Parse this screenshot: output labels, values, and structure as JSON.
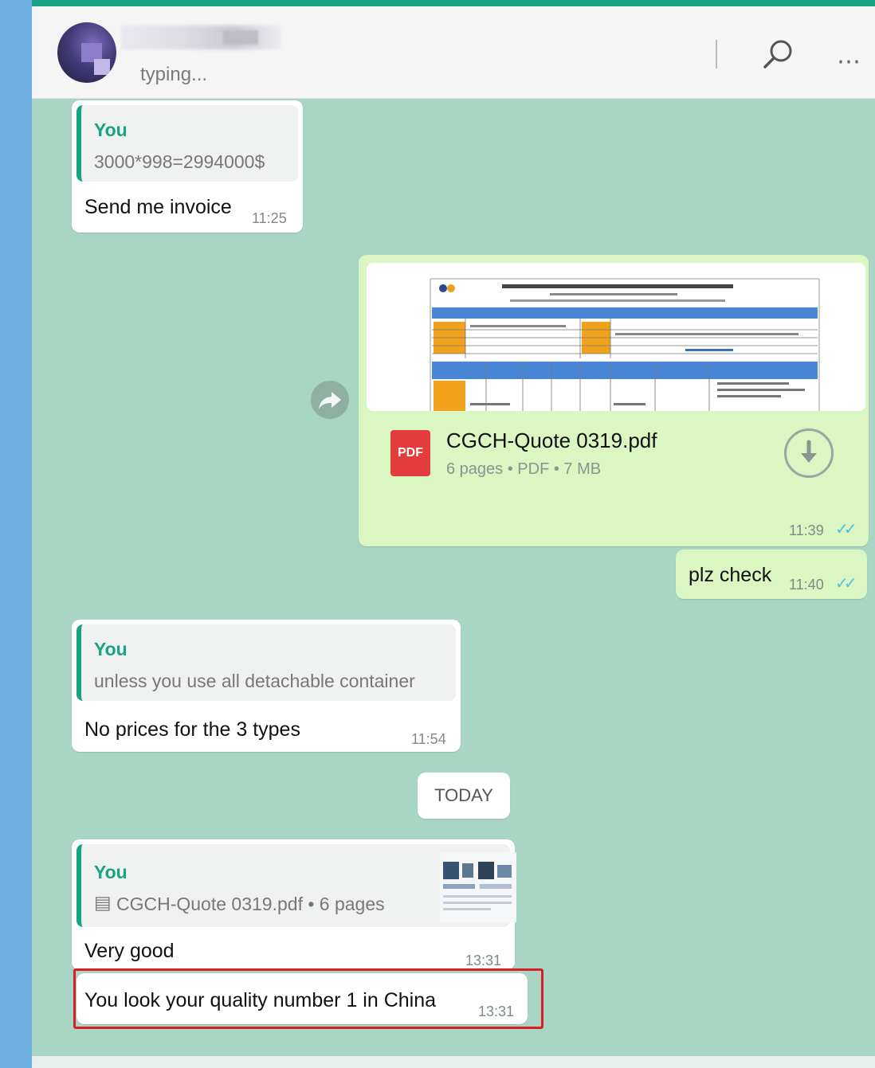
{
  "header": {
    "status": "typing..."
  },
  "icons": {
    "search": "search-icon",
    "more": "more-icon",
    "forward": "forward-icon",
    "download": "download-icon",
    "pdf": "pdf-icon",
    "ticks": "double-check-icon",
    "doc": "document-icon"
  },
  "colors": {
    "accent": "#1aa383",
    "chat_bg": "#a9d5c5",
    "outgoing_bubble": "#d9f6c3",
    "read_ticks": "#53bdeb",
    "highlight": "#d81f26"
  },
  "messages": {
    "m1": {
      "quote_author": "You",
      "quote_text": "3000*998=2994000$",
      "text": "Send me invoice",
      "time": "11:25"
    },
    "m2": {
      "file_name": "CGCH-Quote 0319.pdf",
      "file_meta": "6 pages • PDF • 7 MB",
      "pdf_label": "PDF",
      "time": "11:39",
      "ticks": "✓✓"
    },
    "m3": {
      "text": "plz check",
      "time": "11:40",
      "ticks": "✓✓"
    },
    "m4": {
      "quote_author": "You",
      "quote_text": "unless you use all detachable container",
      "text": "No prices for the 3 types",
      "time": "11:54"
    },
    "date_divider": "TODAY",
    "m5": {
      "quote_author": "You",
      "quote_doc_icon": "▤",
      "quote_text": "CGCH-Quote 0319.pdf • 6 pages",
      "text": "Very good",
      "time": "13:31"
    },
    "m6": {
      "text": "You look your quality number 1 in China",
      "time": "13:31"
    }
  }
}
